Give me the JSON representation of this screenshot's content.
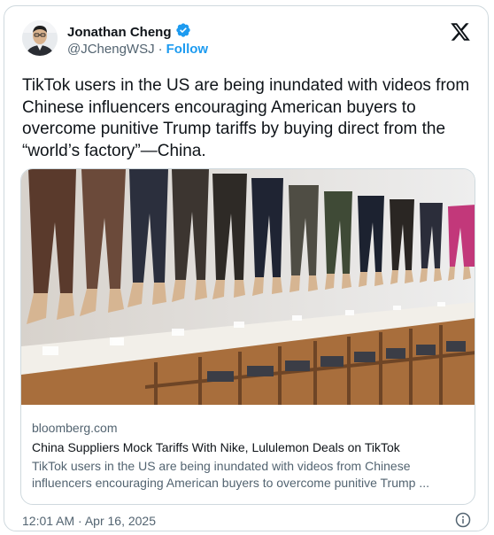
{
  "author": {
    "name": "Jonathan Cheng",
    "handle": "@JChengWSJ",
    "separator": "·",
    "follow_label": "Follow"
  },
  "tweet": {
    "text": "TikTok users in the US are being inundated with videos from Chinese influencers encouraging American buyers to overcome punitive Trump tariffs by buying direct from the “world’s factory”—China.",
    "timestamp": "12:01 AM · Apr 16, 2025"
  },
  "link_card": {
    "domain": "bloomberg.com",
    "title": "China Suppliers Mock Tariffs With Nike, Lululemon Deals on TikTok",
    "description": "TikTok users in the US are being inundated with videos from Chinese influencers encouraging American buyers to overcome punitive Trump ..."
  },
  "colors": {
    "accent": "#1d9bf0",
    "text": "#0f1419",
    "muted": "#536471",
    "border": "#cfd9de"
  },
  "icons": {
    "verified": "verified-badge-icon",
    "platform": "x-logo-icon",
    "info": "info-icon"
  }
}
